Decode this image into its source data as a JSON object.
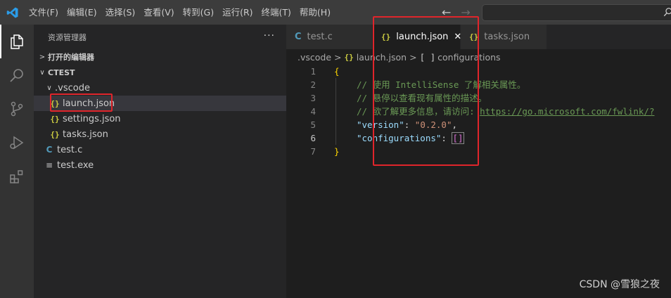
{
  "menu": [
    "文件(F)",
    "编辑(E)",
    "选择(S)",
    "查看(V)",
    "转到(G)",
    "运行(R)",
    "终端(T)",
    "帮助(H)"
  ],
  "nav": {
    "back": "←",
    "forward": "→"
  },
  "sidebar": {
    "title": "资源管理器",
    "more": "···",
    "open_editors": "打开的编辑器",
    "workspace": "CTEST",
    "folder": ".vscode",
    "items": [
      {
        "label": "launch.json",
        "icon": "{}"
      },
      {
        "label": "settings.json",
        "icon": "{}"
      },
      {
        "label": "tasks.json",
        "icon": "{}"
      }
    ],
    "root_files": [
      {
        "label": "test.c",
        "icon": "C"
      },
      {
        "label": "test.exe",
        "icon": "≡"
      }
    ]
  },
  "tabs": [
    {
      "label": "test.c",
      "icon": "C"
    },
    {
      "label": "launch.json",
      "icon": "{}",
      "close": "✕"
    },
    {
      "label": "tasks.json",
      "icon": "{}"
    }
  ],
  "breadcrumb": {
    "folder": ".vscode",
    "file_icon": "{}",
    "file": "launch.json",
    "symbol_icon": "[ ]",
    "symbol": "configurations"
  },
  "code": {
    "line_numbers": [
      "1",
      "2",
      "3",
      "4",
      "5",
      "6",
      "7"
    ],
    "l1": "{",
    "l2": "// 使用 IntelliSense 了解相关属性。",
    "l3": "// 悬停以查看现有属性的描述。",
    "l4_text": "// 欲了解更多信息，请访问: ",
    "l4_link": "https://go.microsoft.com/fwlink/?",
    "l5_key": "\"version\"",
    "l5_colon": ": ",
    "l5_val": "\"0.2.0\"",
    "l5_comma": ",",
    "l6_key": "\"configurations\"",
    "l6_colon": ": ",
    "l6_val": "[]",
    "l7": "}"
  },
  "watermark": "CSDN @雪狼之夜",
  "colors": {
    "highlight": "#e0252b",
    "json_icon": "#cbcb41",
    "c_icon": "#519aba"
  }
}
